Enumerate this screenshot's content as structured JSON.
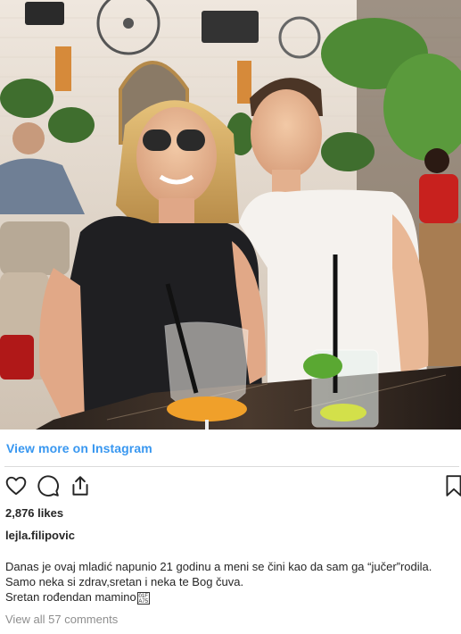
{
  "post": {
    "photo_alt": "",
    "view_more": "View more on Instagram",
    "likes": "2,876 likes",
    "username": "lejla.filipovic",
    "caption": {
      "line1": "Danas je ovaj mladić napunio 21 godinu a meni se čini kao da sam ga “jučer”rodila.",
      "line2": "Samo neka si zdrav,sretan i neka te Bog čuva.",
      "line3": "Sretan rođendan mamino"
    },
    "view_comments": "View all 57 comments"
  },
  "icons": {
    "like": "heart-icon",
    "comment": "comment-icon",
    "share": "share-icon",
    "save": "bookmark-icon"
  },
  "colors": {
    "link": "#3897f0",
    "text": "#262626",
    "muted": "#8e8e8e",
    "divider": "#dbdbdb"
  }
}
